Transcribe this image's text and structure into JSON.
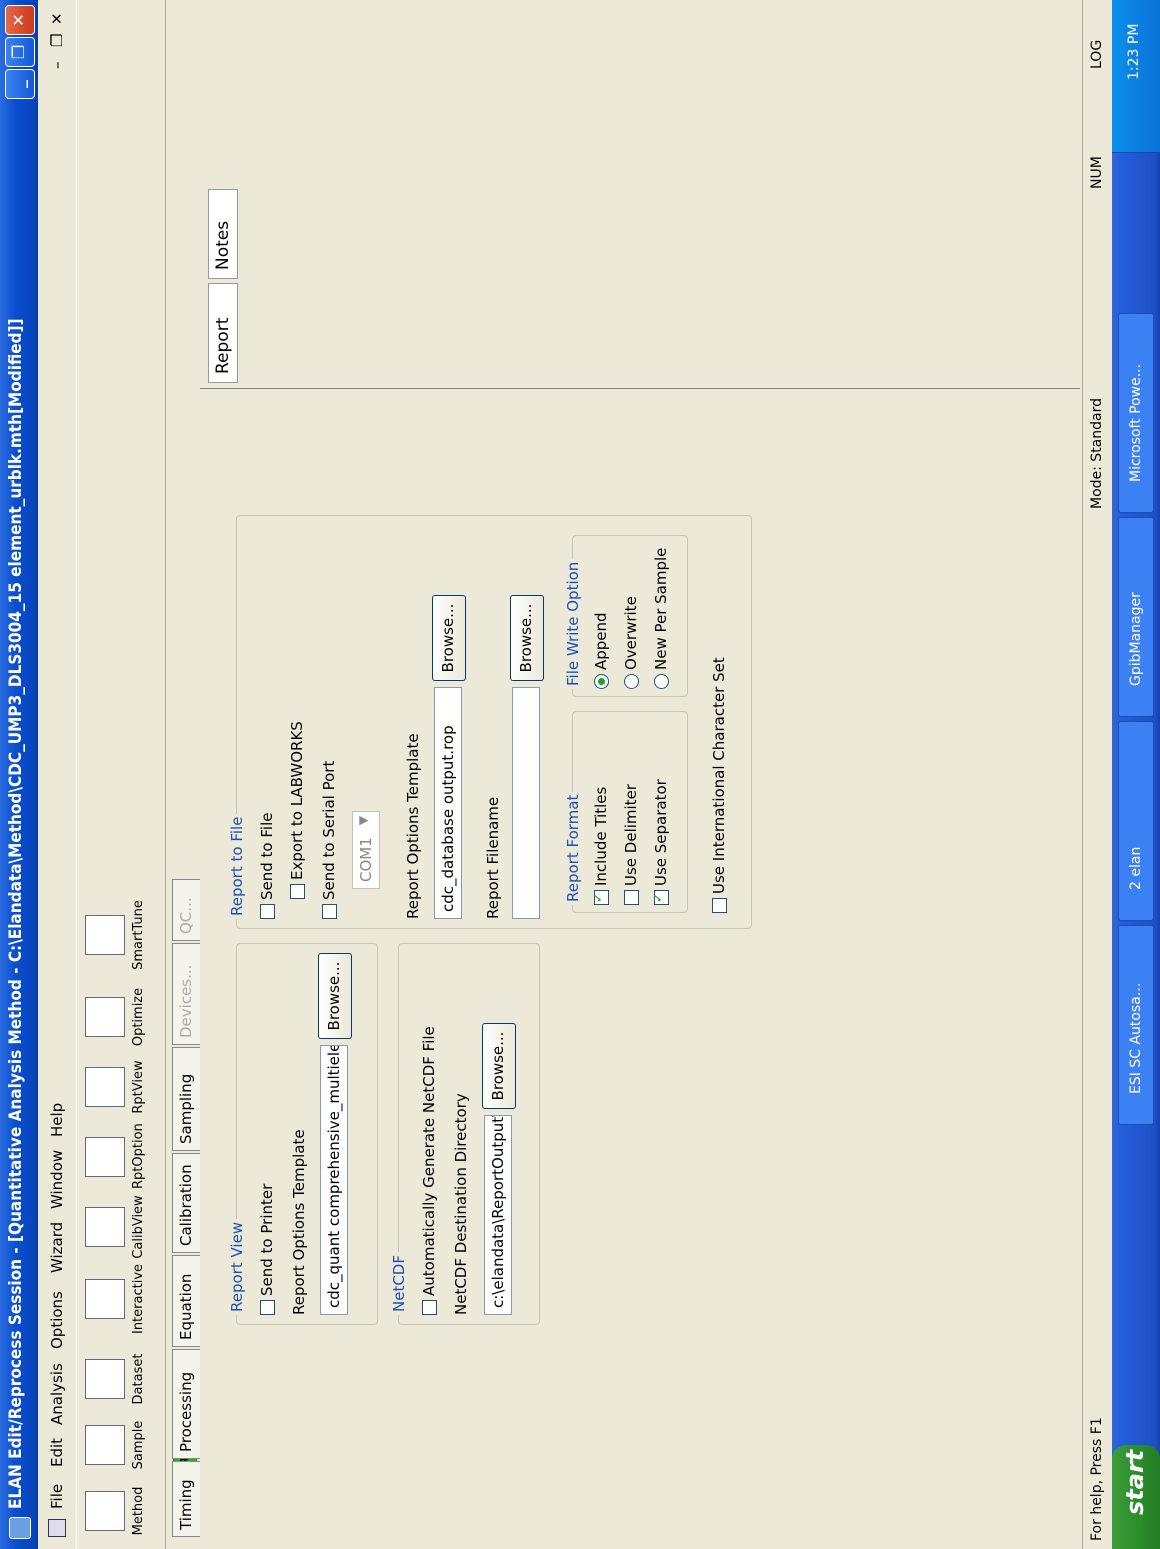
{
  "window": {
    "title": "ELAN Edit/Reprocess Session - [Quantitative Analysis Method - C:\\Elandata\\Method\\CDC_UMP3_DLS3004_15 element_urblk.mth[Modified]]",
    "minimize": "_",
    "restore": "❐",
    "close": "✕"
  },
  "menubar": {
    "items": [
      "File",
      "Edit",
      "Analysis",
      "Options",
      "Wizard",
      "Window",
      "Help"
    ],
    "mdi_min": "–",
    "mdi_restore": "❐",
    "mdi_close": "✕"
  },
  "toolbar": {
    "items": [
      "Method",
      "Sample",
      "Dataset",
      "Interactive",
      "CalibView",
      "RptOption",
      "RptView",
      "Optimize",
      "SmartTune"
    ]
  },
  "method_tabs": {
    "items": [
      "Timing",
      "Processing",
      "Equation",
      "Calibration",
      "Sampling",
      "Devices...",
      "QC..."
    ]
  },
  "report_view": {
    "group_label": "Report View",
    "send_to_printer": "Send to Printer",
    "template_label": "Report Options Template",
    "template_value": "cdc_quant comprehensive_multielen",
    "browse": "Browse..."
  },
  "netcdf": {
    "group_label": "NetCDF",
    "auto_generate": "Automatically Generate NetCDF File",
    "dir_label": "NetCDF Destination Directory",
    "dir_value": "c:\\elandata\\ReportOutput\\",
    "browse": "Browse..."
  },
  "report_file": {
    "group_label": "Report to File",
    "send_to_file": "Send to File",
    "export_labworks": "Export to LABWORKS",
    "send_serial": "Send to Serial Port",
    "com_port": "COM1",
    "template_label": "Report Options Template",
    "template_value": "cdc_database output.rop",
    "browse1": "Browse...",
    "filename_label": "Report Filename",
    "filename_value": "",
    "browse2": "Browse...",
    "format_label": "Report Format",
    "include_titles": "Include Titles",
    "use_delimiter": "Use Delimiter",
    "use_separator": "Use Separator",
    "write_label": "File Write Option",
    "append": "Append",
    "overwrite": "Overwrite",
    "new_per_sample": "New Per Sample",
    "intl_charset": "Use International Character Set"
  },
  "right_tabs": {
    "report": "Report",
    "notes": "Notes"
  },
  "status": {
    "help": "For help, Press F1",
    "mode": "Mode: Standard",
    "num": "NUM",
    "log": "LOG"
  },
  "taskbar": {
    "start": "start",
    "tasks": [
      "ESI SC Autosa...",
      "2 elan",
      "GpibManager",
      "Microsoft Powe..."
    ],
    "clock": "1:23 PM"
  }
}
